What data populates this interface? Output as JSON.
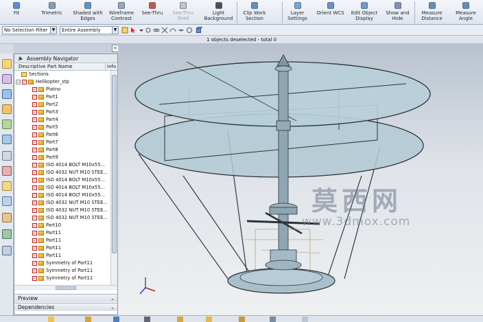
{
  "ribbon": {
    "buttons": [
      {
        "label": "Fit",
        "icon": "fit-icon",
        "enabled": true
      },
      {
        "label": "Trimetric",
        "icon": "trimetric-icon",
        "enabled": true
      },
      {
        "label": "Shaded with Edges",
        "icon": "shaded-with-edges-icon",
        "enabled": true
      },
      {
        "label": "Wireframe Contrast",
        "icon": "wireframe-contrast-icon",
        "enabled": true
      },
      {
        "label": "See-Thru",
        "icon": "see-thru-icon",
        "enabled": true
      },
      {
        "label": "See-Thru Shell",
        "icon": "see-thru-shell-icon",
        "enabled": false
      },
      {
        "label": "Light Background",
        "icon": "light-background-icon",
        "enabled": true
      },
      {
        "label": "Clip Work Section",
        "icon": "clip-work-section-icon",
        "enabled": true
      },
      {
        "label": "Layer Settings",
        "icon": "layer-settings-icon",
        "enabled": true
      },
      {
        "label": "Orient WCS",
        "icon": "orient-wcs-icon",
        "enabled": true
      },
      {
        "label": "Edit Object Display",
        "icon": "edit-object-display-icon",
        "enabled": true
      },
      {
        "label": "Show and Hide",
        "icon": "show-and-hide-icon",
        "enabled": true
      },
      {
        "label": "Measure Distance",
        "icon": "measure-distance-icon",
        "enabled": true
      },
      {
        "label": "Measure Angle",
        "icon": "measure-angle-icon",
        "enabled": true
      }
    ]
  },
  "toolbar2": {
    "selection_filter": "No Selection Filter",
    "scope": "Entire Assembly"
  },
  "status": {
    "message": "1 objects deselected - total 0"
  },
  "navigator": {
    "title": "Assembly Navigator",
    "col_name": "Descriptive Part Name",
    "col_info": "Info",
    "rows": [
      {
        "label": "Sections",
        "level": 0,
        "kind": "folder"
      },
      {
        "label": "Helikopter_stp",
        "level": 0,
        "kind": "assembly"
      },
      {
        "label": "Platno",
        "level": 1,
        "kind": "part"
      },
      {
        "label": "Part1",
        "level": 1,
        "kind": "part"
      },
      {
        "label": "Part2",
        "level": 1,
        "kind": "part"
      },
      {
        "label": "Part3",
        "level": 1,
        "kind": "part"
      },
      {
        "label": "Part4",
        "level": 1,
        "kind": "part"
      },
      {
        "label": "Part5",
        "level": 1,
        "kind": "part"
      },
      {
        "label": "Part6",
        "level": 1,
        "kind": "part"
      },
      {
        "label": "Part7",
        "level": 1,
        "kind": "part"
      },
      {
        "label": "Part8",
        "level": 1,
        "kind": "part"
      },
      {
        "label": "Part9",
        "level": 1,
        "kind": "part"
      },
      {
        "label": "ISO 4014 BOLT M10x55...",
        "level": 1,
        "kind": "part"
      },
      {
        "label": "ISO 4032 NUT M10 STEE...",
        "level": 1,
        "kind": "part"
      },
      {
        "label": "ISO 4014 BOLT M10x55...",
        "level": 1,
        "kind": "part"
      },
      {
        "label": "ISO 4014 BOLT M10x55...",
        "level": 1,
        "kind": "part"
      },
      {
        "label": "ISO 4014 BOLT M10x55...",
        "level": 1,
        "kind": "part"
      },
      {
        "label": "ISO 4032 NUT M10 STEE...",
        "level": 1,
        "kind": "part"
      },
      {
        "label": "ISO 4032 NUT M10 STEE...",
        "level": 1,
        "kind": "part"
      },
      {
        "label": "ISO 4032 NUT M10 STEE...",
        "level": 1,
        "kind": "part"
      },
      {
        "label": "Part10",
        "level": 1,
        "kind": "part"
      },
      {
        "label": "Part11",
        "level": 1,
        "kind": "part"
      },
      {
        "label": "Part11",
        "level": 1,
        "kind": "part"
      },
      {
        "label": "Part11",
        "level": 1,
        "kind": "part"
      },
      {
        "label": "Part11",
        "level": 1,
        "kind": "part"
      },
      {
        "label": "Symmetry of Part11",
        "level": 1,
        "kind": "part"
      },
      {
        "label": "Symmetry of Part11",
        "level": 1,
        "kind": "part"
      },
      {
        "label": "Symmetry of Part11",
        "level": 1,
        "kind": "part"
      }
    ],
    "preview_label": "Preview",
    "dependencies_label": "Dependencies"
  },
  "viewport": {
    "watermark_cn": "莫西网",
    "watermark_url": "www.3dmox.com"
  },
  "colors": {
    "model_fill": "#a9c1cd",
    "model_edge": "#2b3338",
    "ribbon_bg": "#e6ebf2",
    "check_red": "#c01515",
    "part_icon": "#f0b429"
  }
}
